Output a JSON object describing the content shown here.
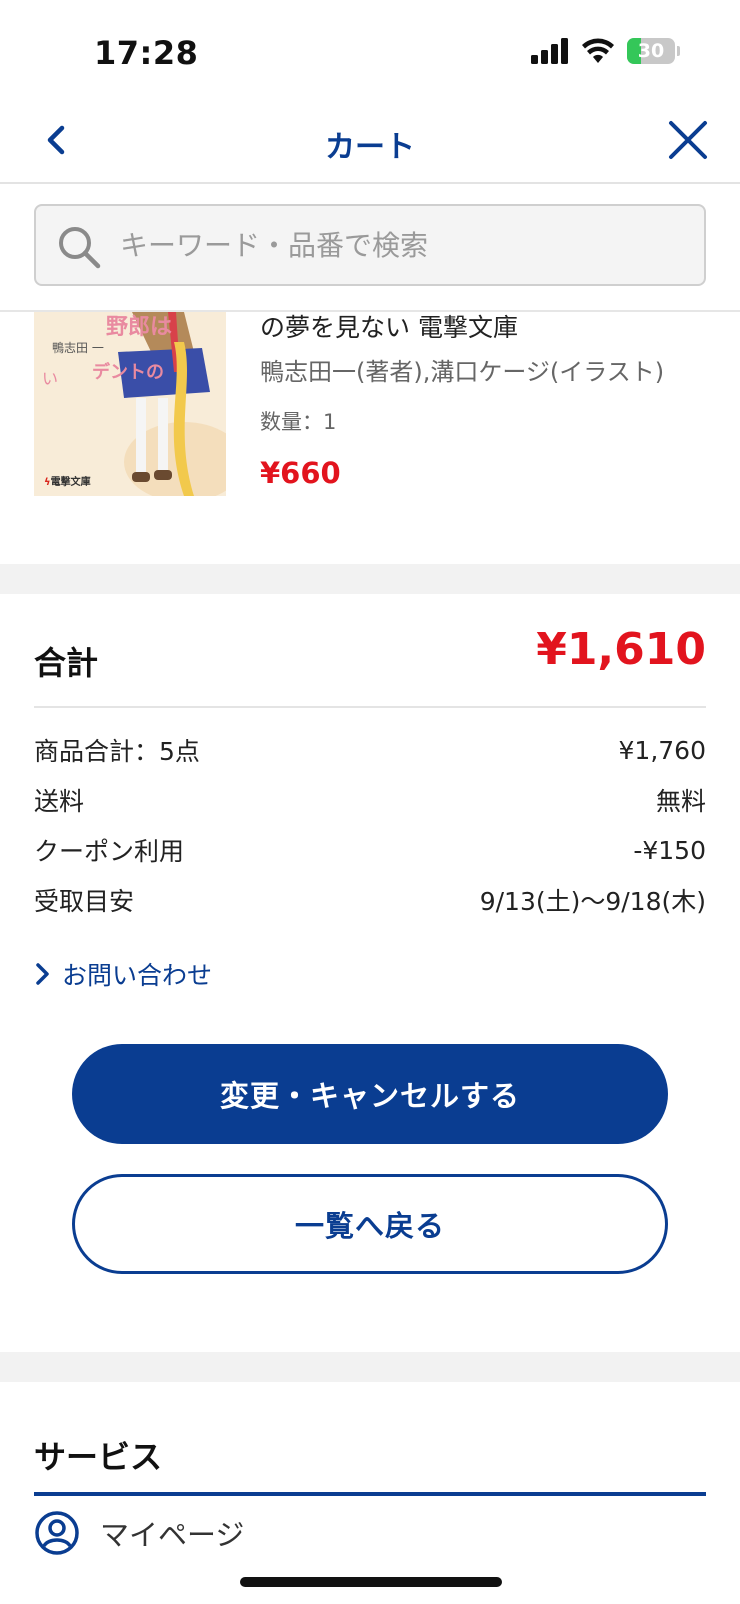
{
  "status_bar": {
    "time": "17:28",
    "battery_level": "30",
    "battery_fraction": 0.3
  },
  "nav": {
    "title": "カート"
  },
  "search": {
    "placeholder": "キーワード・品番で検索"
  },
  "product": {
    "title": "の夢を見ない 電撃文庫",
    "author": "鴨志田一(著者),溝口ケージ(イラスト)",
    "quantity": "数量：1",
    "price": "¥660",
    "cover_text": "電撃文庫"
  },
  "summary": {
    "total_label": "合計",
    "total_value": "¥1,610",
    "rows": [
      {
        "label": "商品合計：5点",
        "value": "¥1,760"
      },
      {
        "label": "送料",
        "value": "無料"
      },
      {
        "label": "クーポン利用",
        "value": "-¥150"
      },
      {
        "label": "受取目安",
        "value": "9/13(土)〜9/18(木)"
      }
    ],
    "inquiry": "お問い合わせ",
    "change_cancel_button": "変更・キャンセルする",
    "back_to_list_button": "一覧へ戻る"
  },
  "services": {
    "title": "サービス",
    "items": [
      {
        "label": "マイページ",
        "icon": "user-circle-icon"
      }
    ]
  },
  "colors": {
    "brand": "#0a3d91",
    "price": "#e2141e",
    "battery": "#34c759"
  }
}
